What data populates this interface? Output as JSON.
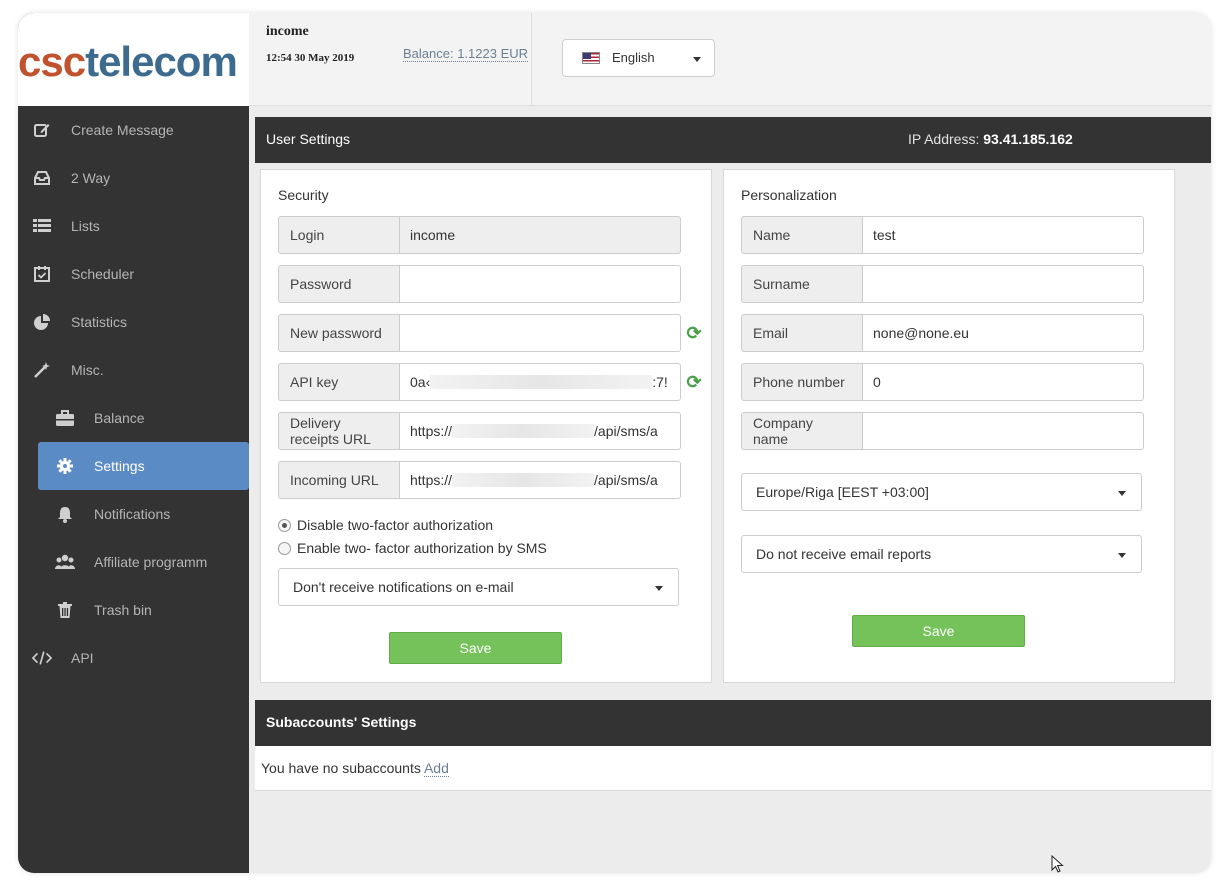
{
  "brand": {
    "part1": "csc",
    "part2": "telecom"
  },
  "header": {
    "username": "income",
    "datetime": "12:54 30 May 2019",
    "balance": "Balance: 1.1223 EUR",
    "language": "English"
  },
  "sidebar": {
    "items": [
      {
        "label": "Create Message",
        "icon": "edit-icon"
      },
      {
        "label": "2 Way",
        "icon": "inbox-icon"
      },
      {
        "label": "Lists",
        "icon": "list-icon"
      },
      {
        "label": "Scheduler",
        "icon": "calendar-icon"
      },
      {
        "label": "Statistics",
        "icon": "pie-chart-icon"
      },
      {
        "label": "Misc.",
        "icon": "magic-wand-icon"
      },
      {
        "label": "Balance",
        "icon": "briefcase-icon"
      },
      {
        "label": "Settings",
        "icon": "gear-icon"
      },
      {
        "label": "Notifications",
        "icon": "bell-icon"
      },
      {
        "label": "Affiliate programm",
        "icon": "users-icon"
      },
      {
        "label": "Trash bin",
        "icon": "trash-icon"
      },
      {
        "label": "API",
        "icon": "code-icon"
      }
    ],
    "active": "Settings"
  },
  "user_settings": {
    "title": "User Settings",
    "ip_label": "IP Address: ",
    "ip_value": "93.41.185.162",
    "security": {
      "title": "Security",
      "login_label": "Login",
      "login_value": "income",
      "password_label": "Password",
      "password_value": "",
      "new_password_label": "New password",
      "new_password_value": "",
      "api_key_label": "API key",
      "api_key_start": "0a‹",
      "api_key_end": ":7!",
      "delivery_label_1": "Delivery",
      "delivery_label_2": "receipts URL",
      "delivery_start": "https://",
      "delivery_end": "/api/sms/a",
      "incoming_label": "Incoming URL",
      "incoming_start": "https://",
      "incoming_end": "/api/sms/a",
      "radio_disable": "Disable two-factor authorization",
      "radio_enable": "Enable two- factor authorization by SMS",
      "notification_select": "Don't receive notifications on e-mail",
      "save_label": "Save"
    },
    "personalization": {
      "title": "Personalization",
      "name_label": "Name",
      "name_value": "test",
      "surname_label": "Surname",
      "surname_value": "",
      "email_label": "Email",
      "email_value": "none@none.eu",
      "phone_label": "Phone number",
      "phone_value": "0",
      "company_label_1": "Company",
      "company_label_2": "name",
      "company_value": "",
      "timezone_select": "Europe/Riga [EEST +03:00]",
      "email_reports_select": "Do not receive email reports",
      "save_label": "Save"
    }
  },
  "subaccounts": {
    "title": "Subaccounts' Settings",
    "empty_text": "You have no subaccounts ",
    "add_label": "Add"
  },
  "colors": {
    "sidebar_bg": "#333333",
    "active_item": "#5b8bc5",
    "save_button": "#75c15a",
    "brand_orange": "#c0532e",
    "brand_blue": "#3d6b8f",
    "refresh_green": "#4aa04a"
  }
}
